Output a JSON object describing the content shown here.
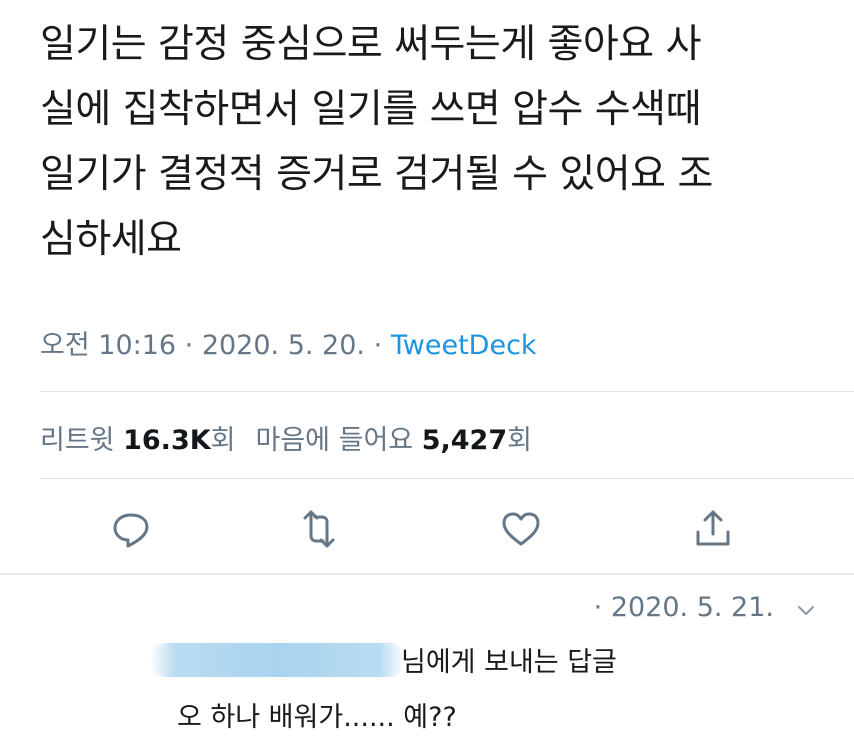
{
  "tweet": {
    "text_lines": [
      "일기는 감정 중심으로 써두는게 좋아요 사",
      "실에 집착하면서 일기를 쓰면 압수 수색때",
      "일기가 결정적 증거로 검거될 수 있어요 조",
      "심하세요"
    ],
    "time": "오전 10:16",
    "separator": " · ",
    "date": "2020. 5. 20.",
    "source": "TweetDeck"
  },
  "stats": {
    "retweet_label": "리트윗 ",
    "retweet_count": "16.3K",
    "retweet_suffix": "회",
    "like_label": "마음에 들어요 ",
    "like_count": "5,427",
    "like_suffix": "회"
  },
  "actions": {
    "icons": [
      "reply-icon",
      "retweet-icon",
      "like-icon",
      "share-icon"
    ]
  },
  "reply": {
    "date": "· 2020. 5. 21.",
    "recipient_suffix": "님에게 보내는 답글",
    "text": "오 하나 배워가...... 예??"
  },
  "colors": {
    "text": "#14171a",
    "secondary": "#657786",
    "link": "#1b95e0",
    "divider": "#e6ecf0"
  }
}
